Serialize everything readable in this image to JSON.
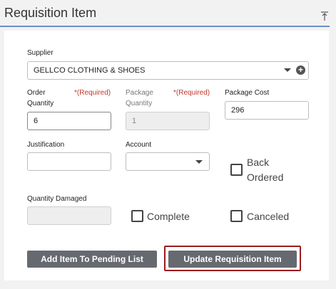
{
  "header": {
    "title": "Requisition Item"
  },
  "form": {
    "supplier": {
      "label": "Supplier",
      "value": "GELLCO CLOTHING & SHOES"
    },
    "order_quantity": {
      "label_line1": "Order",
      "label_line2": "Quantity",
      "required": "*(Required)",
      "value": "6"
    },
    "package_quantity": {
      "label_line1": "Package",
      "label_line2": "Quantity",
      "required": "*(Required)",
      "value": "1"
    },
    "package_cost": {
      "label": "Package Cost",
      "value": "296"
    },
    "justification": {
      "label": "Justification",
      "value": ""
    },
    "account": {
      "label": "Account",
      "value": ""
    },
    "back_ordered": {
      "label_line1": "Back",
      "label_line2": "Ordered",
      "checked": false
    },
    "quantity_damaged": {
      "label": "Quantity Damaged",
      "value": ""
    },
    "complete": {
      "label": "Complete",
      "checked": false
    },
    "canceled": {
      "label": "Canceled",
      "checked": false
    }
  },
  "actions": {
    "add_pending_label": "Add Item To Pending List",
    "update_label": "Update Requisition Item"
  },
  "colors": {
    "header_rule": "#6b8fc7",
    "required": "#c0392b",
    "button": "#666a70",
    "highlight": "#9b1c1c"
  }
}
